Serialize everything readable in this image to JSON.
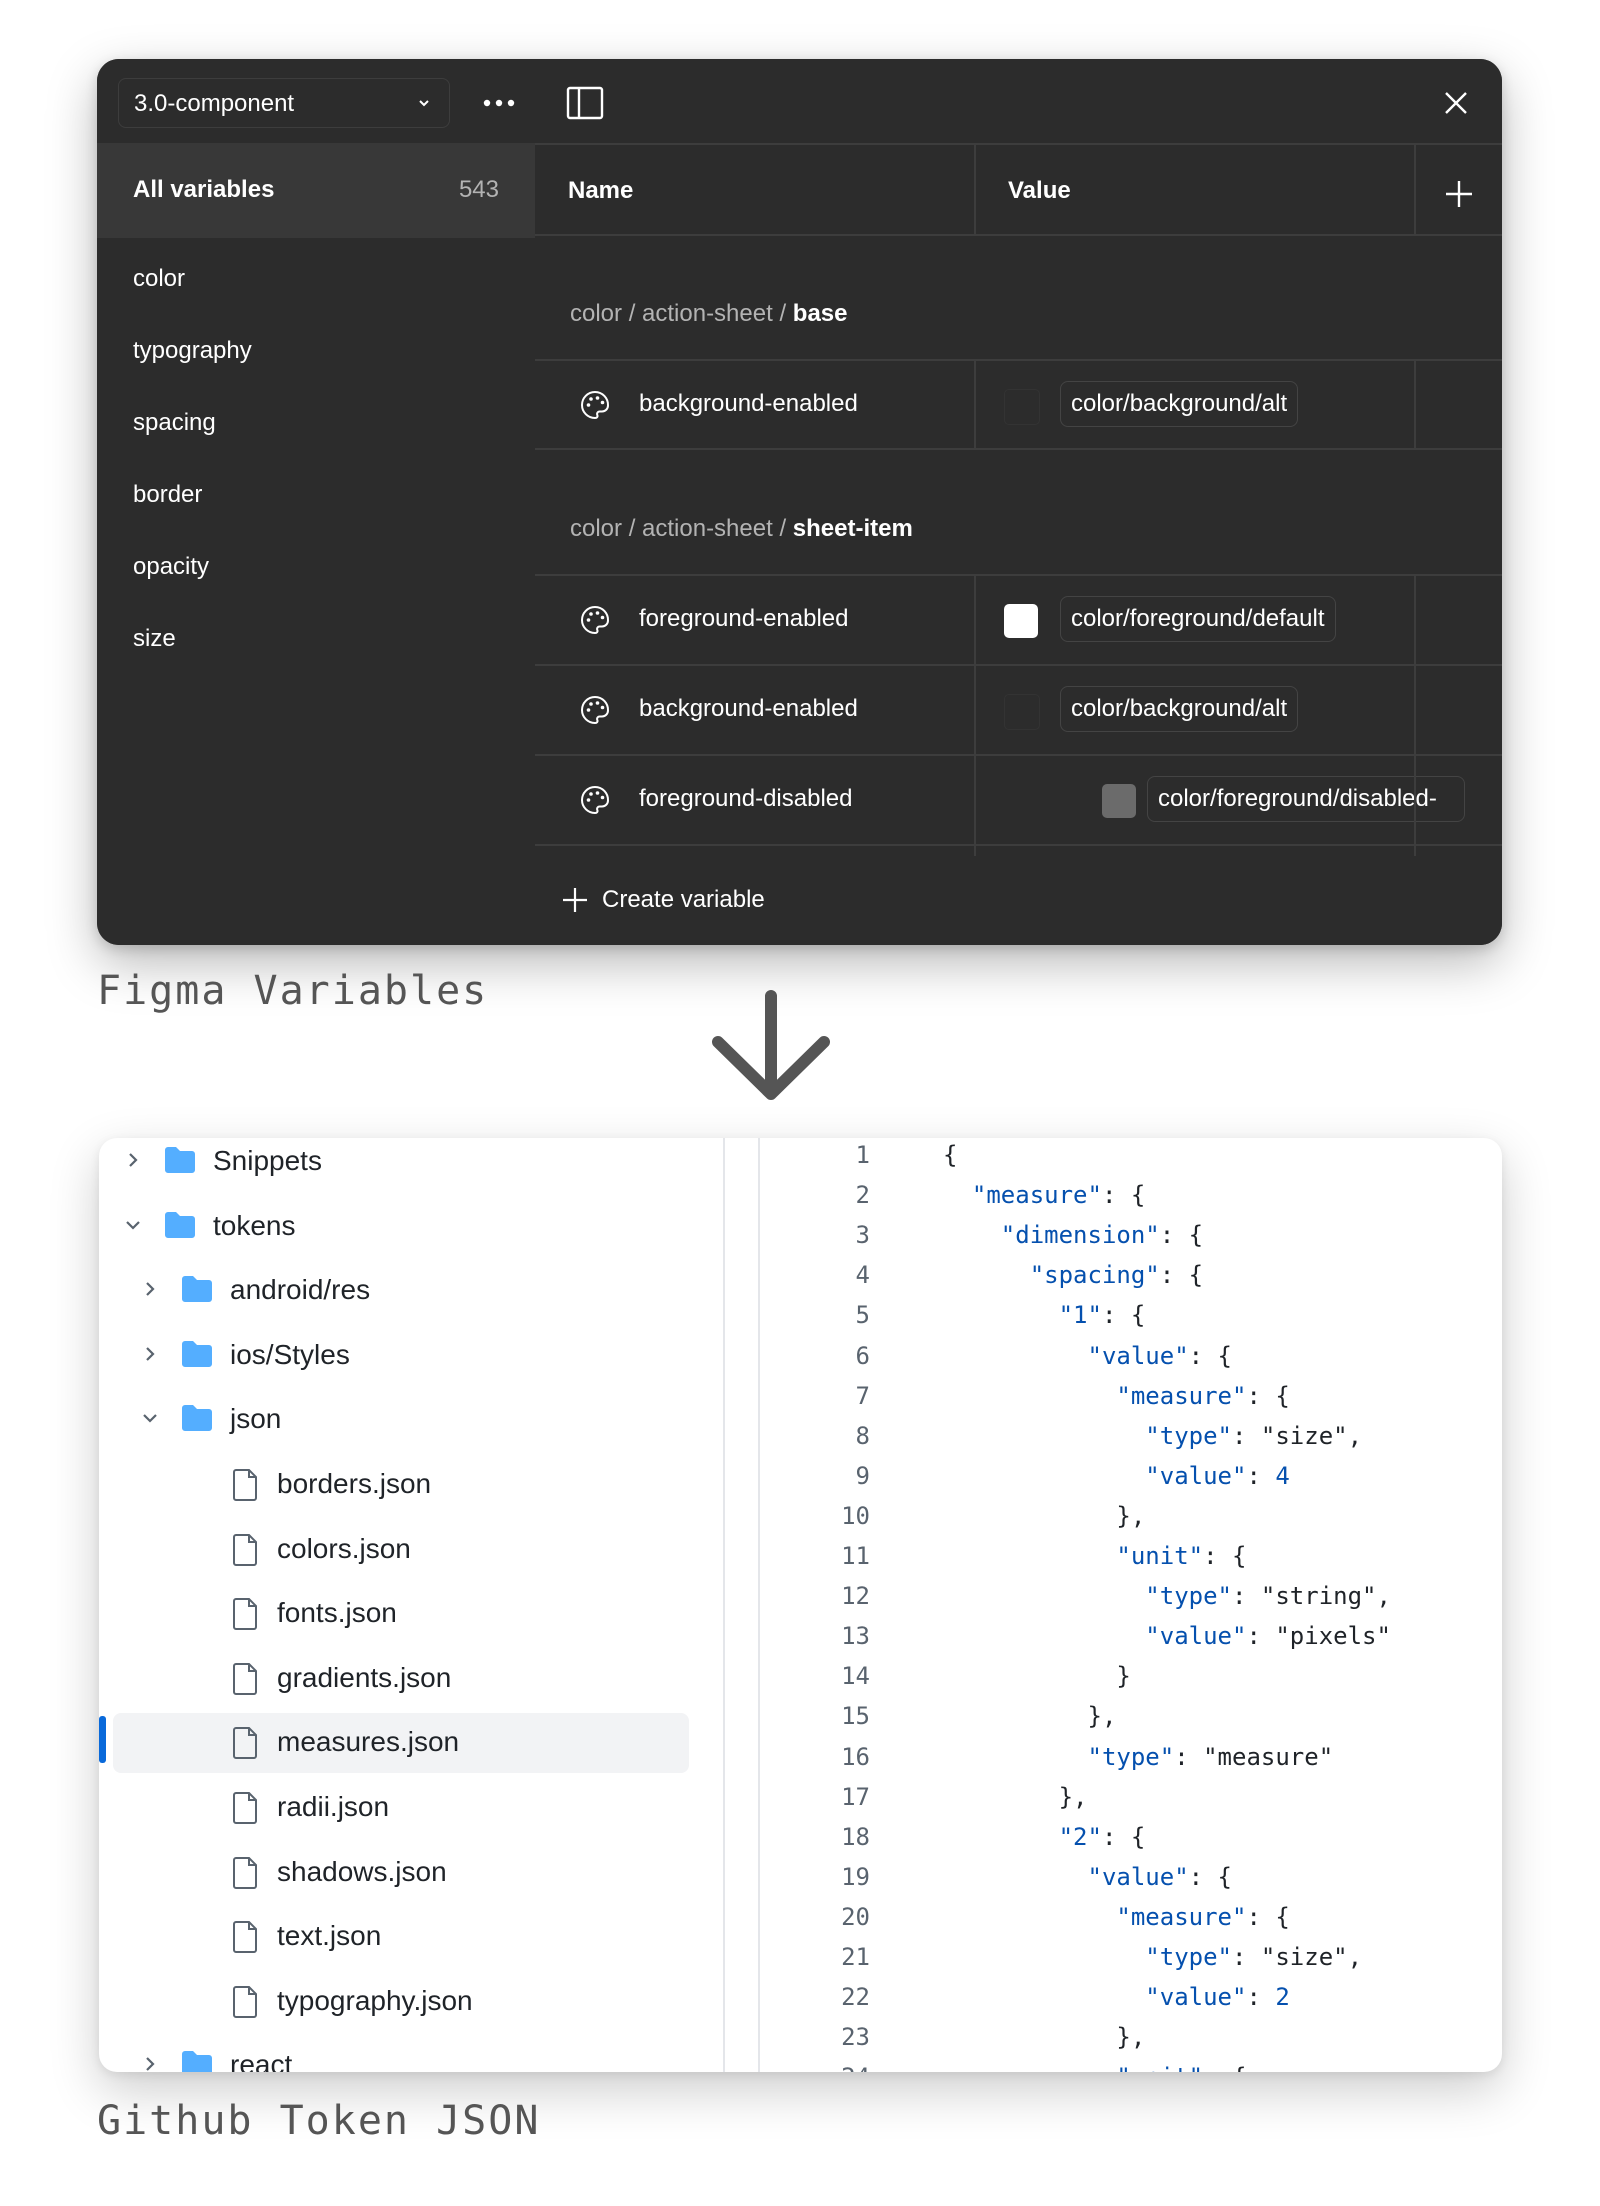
{
  "figma": {
    "collection": "3.0-component",
    "all_variables_label": "All variables",
    "all_variables_count": "543",
    "groups": [
      "color",
      "typography",
      "spacing",
      "border",
      "opacity",
      "size"
    ],
    "headers": {
      "name": "Name",
      "value": "Value"
    },
    "sections": [
      {
        "path_prefix": "color / action-sheet / ",
        "path_last": "base"
      },
      {
        "path_prefix": "color / action-sheet / ",
        "path_last": "sheet-item"
      }
    ],
    "rows": [
      {
        "name": "background-enabled",
        "alias": "color/background/alt",
        "swatch": "#2c2c2c"
      },
      {
        "name": "foreground-enabled",
        "alias": "color/foreground/default",
        "swatch": "#ffffff"
      },
      {
        "name": "background-enabled",
        "alias": "color/background/alt",
        "swatch": "#2c2c2c"
      },
      {
        "name": "foreground-disabled",
        "alias": "color/foreground/disabled-",
        "swatch": "#6b6b6b"
      }
    ],
    "create_label": "Create variable"
  },
  "captions": {
    "figma": "Figma Variables",
    "github": "Github Token JSON"
  },
  "github": {
    "tree": [
      {
        "name": "Snippets",
        "type": "folder",
        "state": "collapsed"
      },
      {
        "name": "tokens",
        "type": "folder",
        "state": "expanded"
      },
      {
        "name": "android/res",
        "type": "folder",
        "state": "collapsed"
      },
      {
        "name": "ios/Styles",
        "type": "folder",
        "state": "collapsed"
      },
      {
        "name": "json",
        "type": "folder",
        "state": "expanded"
      },
      {
        "name": "borders.json",
        "type": "file"
      },
      {
        "name": "colors.json",
        "type": "file"
      },
      {
        "name": "fonts.json",
        "type": "file"
      },
      {
        "name": "gradients.json",
        "type": "file"
      },
      {
        "name": "measures.json",
        "type": "file",
        "selected": true
      },
      {
        "name": "radii.json",
        "type": "file"
      },
      {
        "name": "shadows.json",
        "type": "file"
      },
      {
        "name": "text.json",
        "type": "file"
      },
      {
        "name": "typography.json",
        "type": "file"
      },
      {
        "name": "react",
        "type": "folder",
        "state": "collapsed"
      }
    ],
    "code_lines": [
      "{",
      "  \"measure\": {",
      "    \"dimension\": {",
      "      \"spacing\": {",
      "        \"1\": {",
      "          \"value\": {",
      "            \"measure\": {",
      "              \"type\": \"size\",",
      "              \"value\": 4",
      "            },",
      "            \"unit\": {",
      "              \"type\": \"string\",",
      "              \"value\": \"pixels\"",
      "            }",
      "          },",
      "          \"type\": \"measure\"",
      "        },",
      "        \"2\": {",
      "          \"value\": {",
      "            \"measure\": {",
      "              \"type\": \"size\",",
      "              \"value\": 2",
      "            },",
      "            \"unit\": {"
    ]
  },
  "colors": {
    "figma_bg": "#2c2c2c",
    "accent": "#0969da",
    "json_key": "#0550ae"
  }
}
